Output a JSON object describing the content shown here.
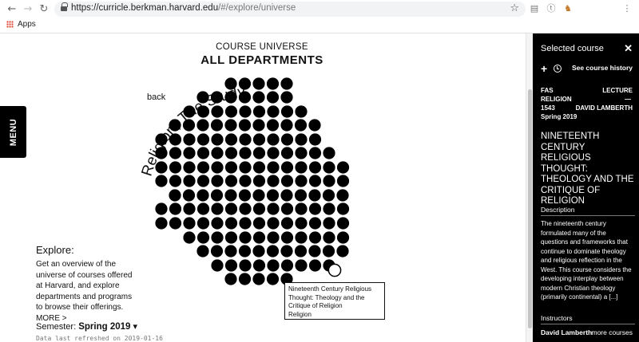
{
  "browser": {
    "url_main": "https://curricle.berkman.harvard.edu",
    "url_hash": "/#/explore/universe",
    "bookmarks": [
      "Apps"
    ]
  },
  "menu_tab": "MENU",
  "header": {
    "subtitle": "COURSE UNIVERSE",
    "title": "ALL DEPARTMENTS"
  },
  "back_label": "back",
  "department_label": "Religion, The Study of",
  "explore": {
    "heading": "Explore:",
    "text": "Get an overview of the universe of courses offered at Harvard, and explore departments and programs to browse their offerings. MORE >"
  },
  "semester": {
    "label": "Semester:",
    "value": "Spring 2019",
    "caret": "▾"
  },
  "refreshed": "Data last refreshed on 2019-01-16",
  "tooltip": {
    "title": "Nineteenth Century Religious Thought: Theology and the Critique of Religion",
    "department": "Religion"
  },
  "panel": {
    "heading": "Selected course",
    "close": "✕",
    "history_link": "See course history",
    "school": "FAS",
    "type": "LECTURE",
    "subject": "RELIGION",
    "dash": "—",
    "number": "1543",
    "instructor_short": "DAVID LAMBERTH",
    "term": "Spring 2019",
    "course_title": "NINETEENTH CENTURY RELIGIOUS THOUGHT: THEOLOGY AND THE CRITIQUE OF RELIGION",
    "description_heading": "Description",
    "description": "The nineteenth century formulated many of the questions and frameworks that continue to dominate theology and religious reflection in the West. This course considers the developing interplay between modern Christian theology (primarily continental) a [...]",
    "instructors_heading": "Instructors",
    "instructor": "David Lamberth",
    "more_courses": "more courses"
  },
  "colors": {
    "dot": "#000000",
    "selected_dot": "#ffffff",
    "panel_bg": "#000000"
  }
}
